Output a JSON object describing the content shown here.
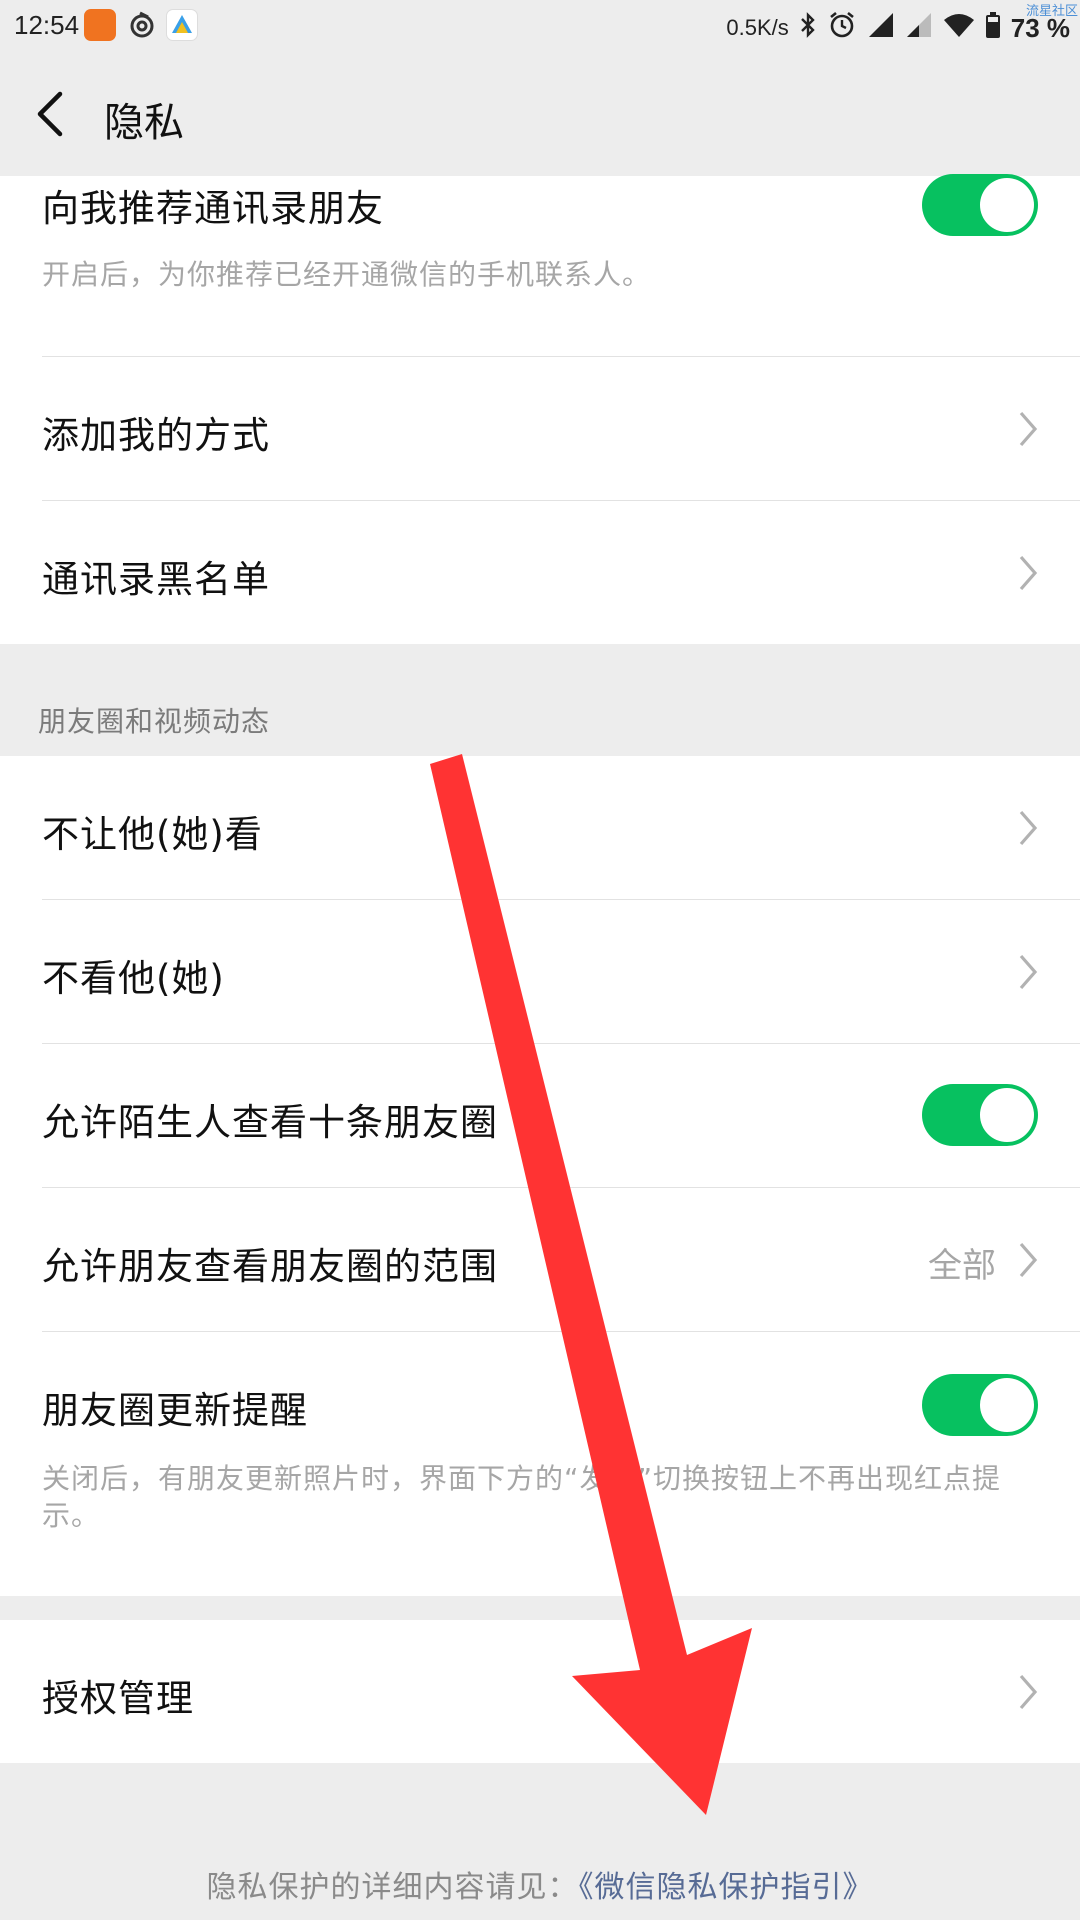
{
  "status_bar": {
    "time": "12:54",
    "net_speed": "0.5K/s",
    "battery": "73 %",
    "watermark": "流星社区",
    "icons": [
      "app-icon",
      "netease-icon",
      "app-icon",
      "bluetooth-icon",
      "alarm-icon",
      "signal-icon",
      "signal-icon",
      "wifi-icon",
      "battery-icon"
    ]
  },
  "header": {
    "title": "隐私",
    "back_icon": "chevron-left-icon"
  },
  "section1": {
    "rows": [
      {
        "label": "向我推荐通讯录朋友",
        "desc": "开启后，为你推荐已经开通微信的手机联系人。",
        "toggle": true
      },
      {
        "label": "添加我的方式"
      },
      {
        "label": "通讯录黑名单"
      }
    ]
  },
  "section2": {
    "header": "朋友圈和视频动态",
    "rows": [
      {
        "label": "不让他(她)看"
      },
      {
        "label": "不看他(她)"
      },
      {
        "label": "允许陌生人查看十条朋友圈",
        "toggle": true
      },
      {
        "label": "允许朋友查看朋友圈的范围",
        "value": "全部"
      },
      {
        "label": "朋友圈更新提醒",
        "desc": "关闭后，有朋友更新照片时，界面下方的“发现”切换按钮上不再出现红点提示。",
        "toggle": true
      }
    ]
  },
  "section3": {
    "rows": [
      {
        "label": "授权管理"
      }
    ]
  },
  "footer": {
    "text": "隐私保护的详细内容请见：",
    "link": "《微信隐私保护指引》"
  },
  "colors": {
    "toggle_on": "#07c160",
    "link": "#576b95",
    "arrow": "#ff3333",
    "page_bg": "#ededed"
  }
}
